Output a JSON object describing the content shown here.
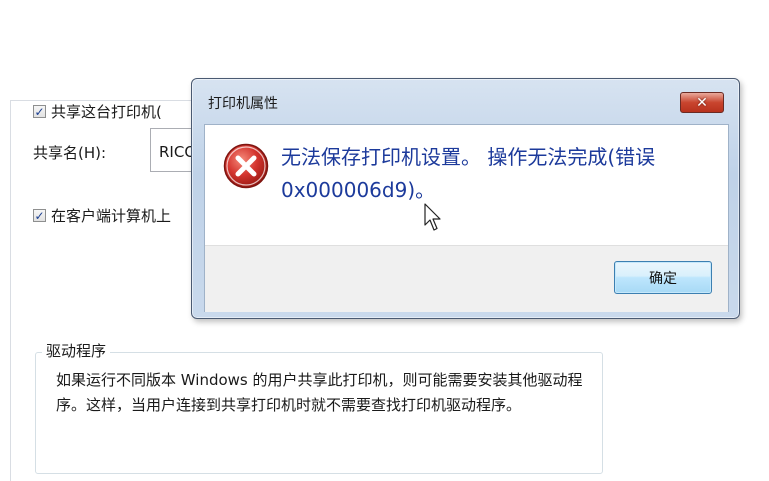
{
  "background_panel": {
    "share_printer_checkbox_label": "共享这台打印机(",
    "share_name_label": "共享名(H):",
    "share_name_value": "RICO",
    "client_render_checkbox_label": "在客户端计算机上",
    "driver_group": {
      "title": "驱动程序",
      "text": "如果运行不同版本 Windows 的用户共享此打印机，则可能需要安装其他驱动程序。这样，当用户连接到共享打印机时就不需要查找打印机驱动程序。"
    }
  },
  "dialog": {
    "title": "打印机属性",
    "close_glyph": "✕",
    "icon": "error-icon",
    "message": "无法保存打印机设置。 操作无法完成(错误 0x000006d9)。",
    "ok_label": "确定"
  },
  "colors": {
    "message_text": "#1c3a9b",
    "error_red": "#d4352f",
    "close_button": "#c9452f"
  }
}
